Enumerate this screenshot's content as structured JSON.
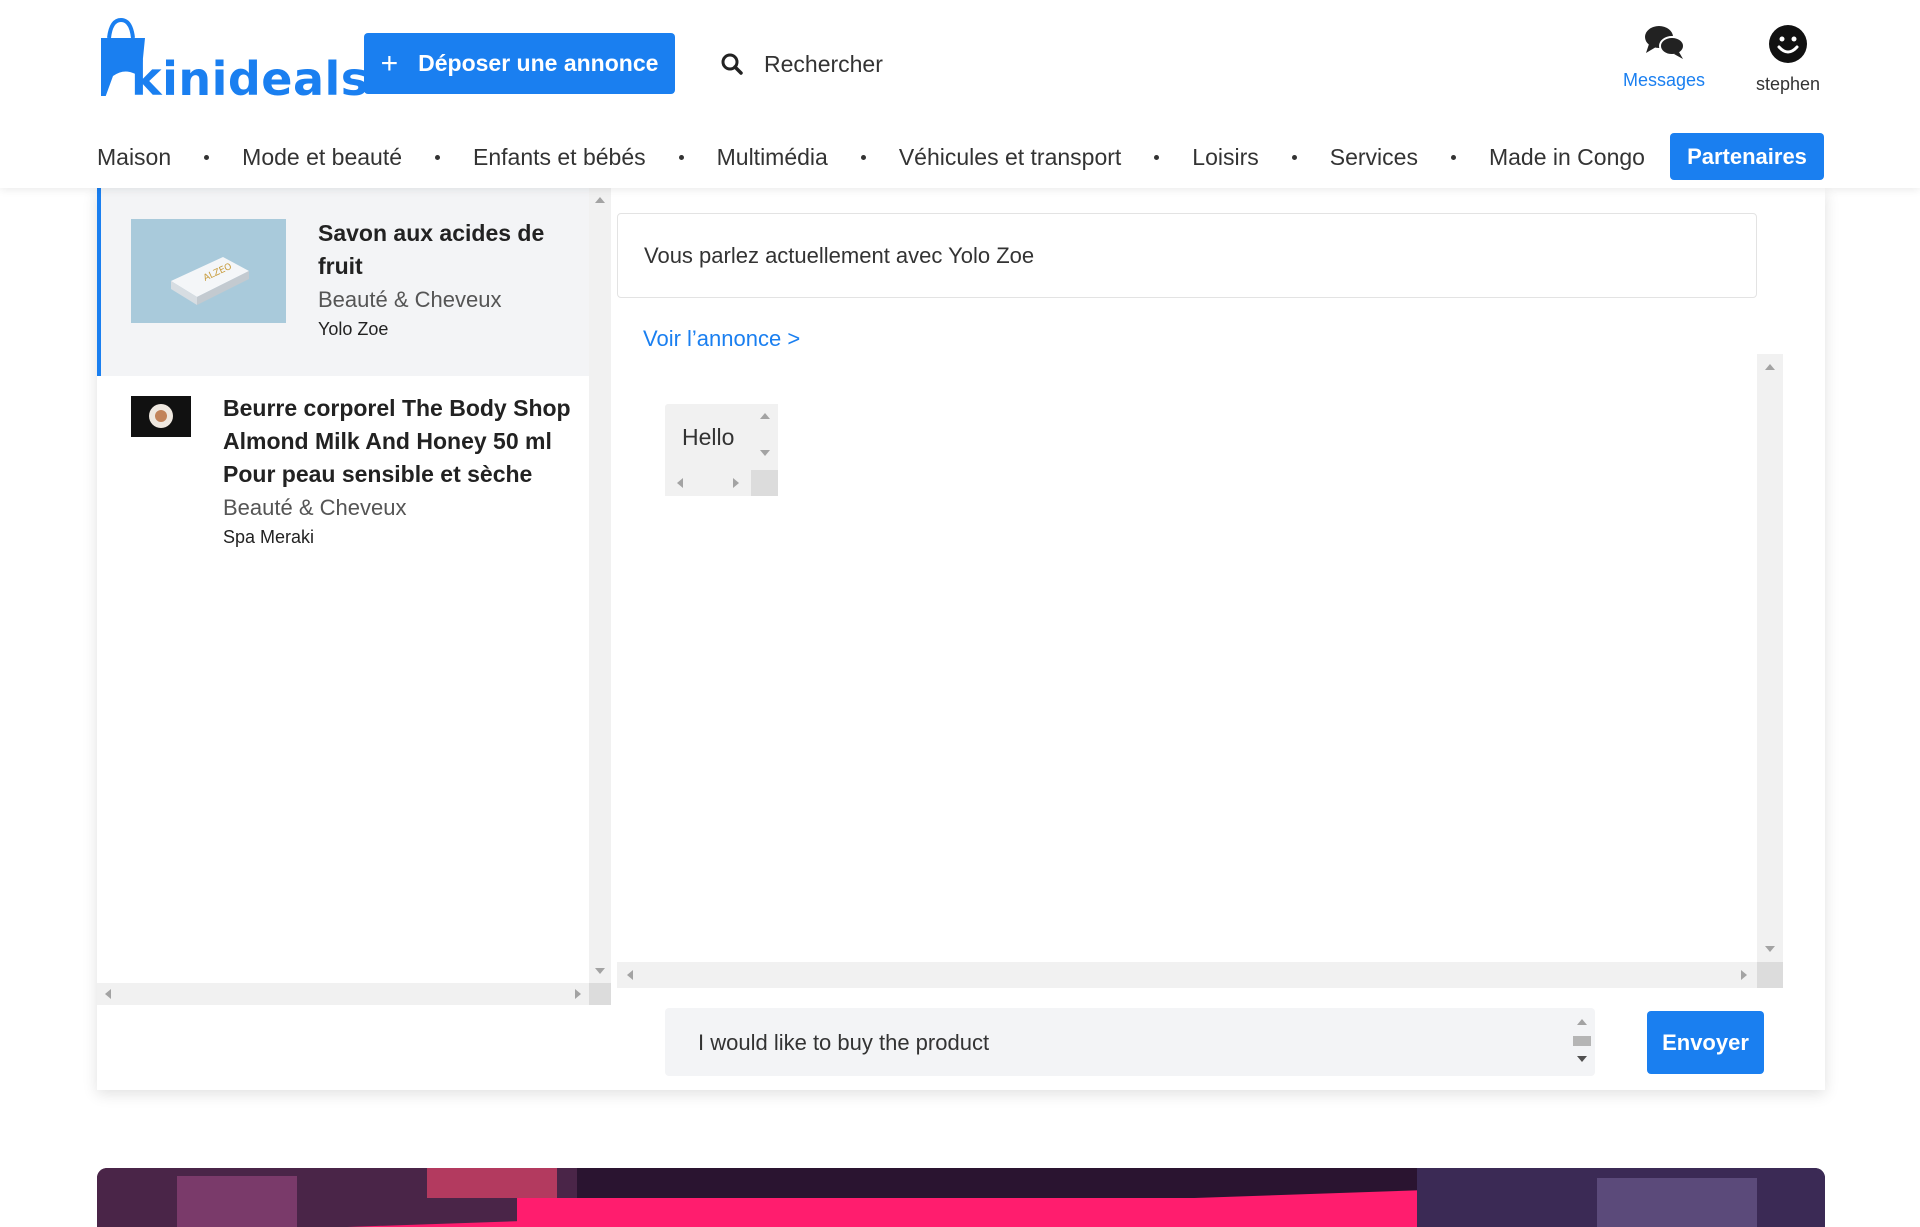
{
  "header": {
    "logo_text": "kinideals",
    "post_ad_label": "Déposer une annonce",
    "search_label": "Rechercher",
    "messages_label": "Messages",
    "user_label": "stephen",
    "icons": {
      "plus": "plus-icon",
      "search": "search-icon",
      "messages": "chat-bubbles-icon",
      "user": "smiley-face-icon"
    }
  },
  "nav": {
    "items": [
      "Maison",
      "Mode et beauté",
      "Enfants et bébés",
      "Multimédia",
      "Véhicules et transport",
      "Loisirs",
      "Services",
      "Made in Congo"
    ],
    "partners_label": "Partenaires"
  },
  "conversations": [
    {
      "title_line1": "Savon aux acides de",
      "title_line2": "fruit",
      "category": "Beauté & Cheveux",
      "seller": "Yolo Zoe",
      "active": true
    },
    {
      "title_line1": "Beurre corporel The Body Shop",
      "title_line2": "Almond Milk And Honey 50 ml",
      "title_line3": "Pour peau sensible et sèche",
      "category": "Beauté & Cheveux",
      "seller": "Spa Meraki",
      "active": false
    }
  ],
  "chat": {
    "header_text": "Vous parlez actuellement avec Yolo Zoe",
    "view_ad_link": "Voir l’annonce >",
    "messages": [
      {
        "text": "Hello"
      }
    ],
    "composer_value": "I would like to buy the product",
    "send_label": "Envoyer"
  },
  "colors": {
    "accent": "#1a7ff0",
    "active_bg": "#f3f4f6"
  }
}
